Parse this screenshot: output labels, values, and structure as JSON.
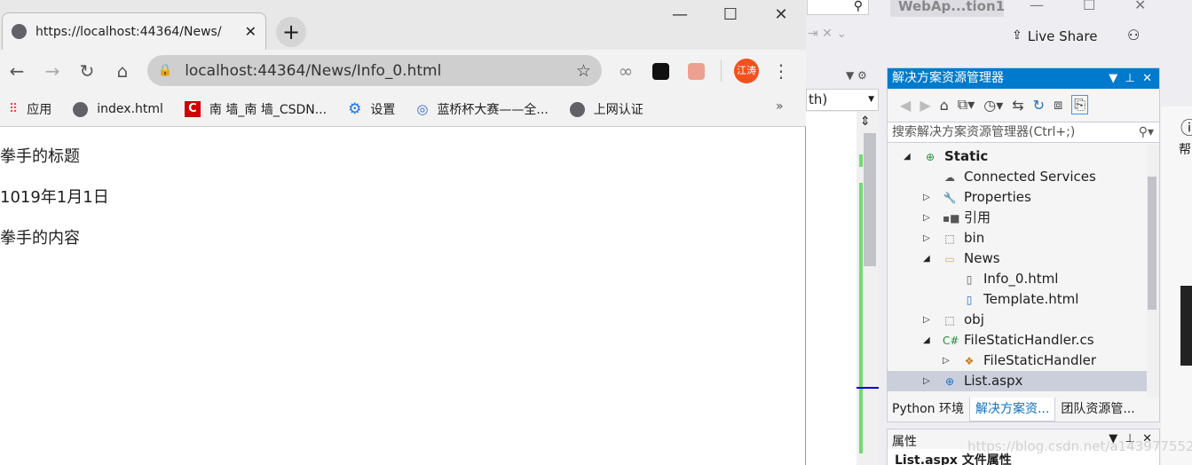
{
  "browser": {
    "tab_title": "https://localhost:44364/News/",
    "new_tab": "+",
    "address": "localhost:44364/News/Info_0.html",
    "profile": "江涛",
    "bookmarks": [
      {
        "label": "应用",
        "icon": "apps-grid-icon"
      },
      {
        "label": "index.html",
        "icon": "globe-icon"
      },
      {
        "label": "南 墙_南 墙_CSDN...",
        "icon": "csdn-icon"
      },
      {
        "label": "设置",
        "icon": "gear-icon"
      },
      {
        "label": "蓝桥杯大赛——全...",
        "icon": "lanqiao-icon"
      },
      {
        "label": "上网认证",
        "icon": "globe-icon"
      }
    ],
    "more": "»",
    "page": {
      "title": "拳手的标题",
      "date": "1019年1月1日",
      "content": "拳手的内容"
    }
  },
  "vs": {
    "window_title": "WebAp...tion1",
    "live_share": "Live Share",
    "dropdown_value": "th)",
    "solution_explorer": {
      "title": "解决方案资源管理器",
      "search_placeholder": "搜索解决方案资源管理器(Ctrl+;)",
      "tree": [
        {
          "label": "Static",
          "level": 0,
          "expander": "◢",
          "icon": "web-project-icon",
          "bold": true
        },
        {
          "label": "Connected Services",
          "level": 1,
          "expander": "",
          "icon": "connected-services-icon"
        },
        {
          "label": "Properties",
          "level": 1,
          "expander": "▷",
          "icon": "wrench-icon"
        },
        {
          "label": "引用",
          "level": 1,
          "expander": "▷",
          "icon": "references-icon"
        },
        {
          "label": "bin",
          "level": 1,
          "expander": "▷",
          "icon": "folder-dotted-icon"
        },
        {
          "label": "News",
          "level": 1,
          "expander": "◢",
          "icon": "folder-open-icon"
        },
        {
          "label": "Info_0.html",
          "level": 2,
          "expander": "",
          "icon": "file-icon"
        },
        {
          "label": "Template.html",
          "level": 2,
          "expander": "",
          "icon": "html-file-icon"
        },
        {
          "label": "obj",
          "level": 1,
          "expander": "▷",
          "icon": "folder-dotted-icon"
        },
        {
          "label": "FileStaticHandler.cs",
          "level": 1,
          "expander": "◢",
          "icon": "csharp-icon"
        },
        {
          "label": "FileStaticHandler",
          "level": 2,
          "expander": "▷",
          "icon": "class-icon"
        },
        {
          "label": "List.aspx",
          "level": 1,
          "expander": "▷",
          "icon": "aspx-file-icon",
          "selected": true
        }
      ]
    },
    "bottom_tabs": [
      "Python 环境",
      "解决方案资...",
      "团队资源管..."
    ],
    "active_tab": 1,
    "properties": {
      "title": "属性",
      "subtitle": "List.aspx  文件属性"
    },
    "right_strip": "帮",
    "watermark": "https://blog.csdn.net/a1439775520"
  },
  "colors": {
    "accent": "#007acc",
    "selection": "#cbcfdc",
    "change_bar": "#6fdc6f",
    "profile": "#f4511e"
  }
}
